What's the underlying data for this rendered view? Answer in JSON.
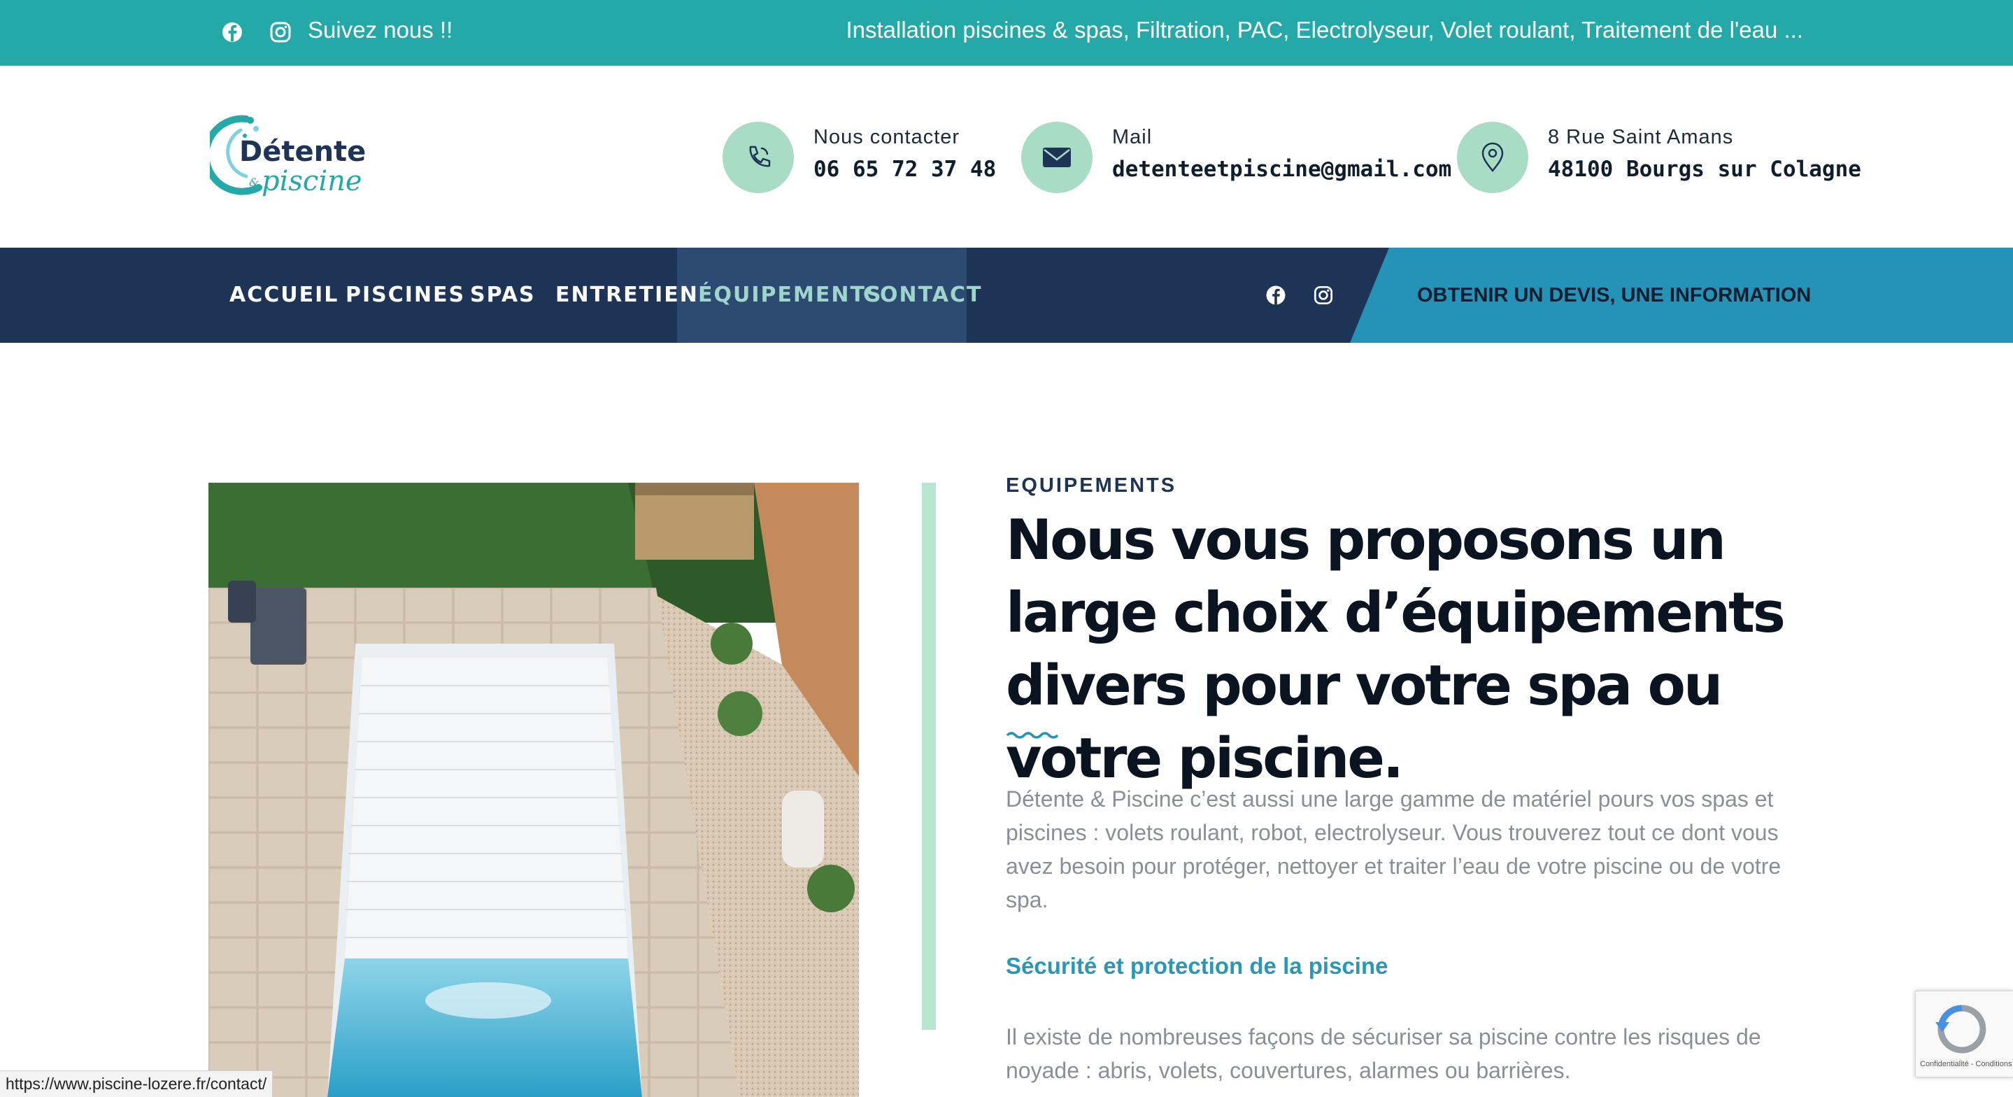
{
  "topbar": {
    "follow_label": "Suivez nous !!",
    "tagline": "Installation piscines & spas, Filtration, PAC, Electrolyseur, Volet roulant, Traitement de l'eau ...",
    "icons": [
      "facebook-icon",
      "instagram-icon"
    ]
  },
  "header": {
    "logo": {
      "line1": "Détente",
      "amp": "&",
      "line2": "piscine"
    },
    "contacts": [
      {
        "icon": "phone-icon",
        "label": "Nous contacter",
        "value": "06 65 72 37 48"
      },
      {
        "icon": "envelope-icon",
        "label": "Mail",
        "value": "detenteetpiscine@gmail.com"
      },
      {
        "icon": "map-pin-icon",
        "label": "8 Rue Saint Amans",
        "value": "48100 Bourgs sur Colagne"
      }
    ]
  },
  "nav": {
    "items": [
      "ACCUEIL",
      "PISCINES",
      "SPAS",
      "ENTRETIEN",
      "ÉQUIPEMENTS",
      "CONTACT"
    ],
    "active": "ÉQUIPEMENTS",
    "cta": "OBTENIR UN DEVIS, UNE INFORMATION"
  },
  "main": {
    "eyebrow": "EQUIPEMENTS",
    "headline": "Nous vous proposons un large choix d’équipements divers pour votre spa ou votre piscine.",
    "intro": "Détente & Piscine c’est aussi une large gamme de matériel pours vos spas et piscines : volets roulant, robot, electrolyseur. Vous trouverez tout ce dont vous avez besoin pour protéger, nettoyer et traiter l’eau de votre piscine ou de votre spa.",
    "subheading": "Sécurité et protection de la piscine",
    "security_text": "Il existe de nombreuses façons de sécuriser sa piscine contre les risques de noyade : abris, volets, couvertures, alarmes ou barrières."
  },
  "status_url": "https://www.piscine-lozere.fr/contact/",
  "recaptcha": {
    "text": "Confidentialité - Conditions"
  },
  "colors": {
    "topbar": "#25a8a8",
    "nav": "#1e3457",
    "cta": "#2593b8",
    "accent_green": "#a8dcc4",
    "link_blue": "#2a98b5"
  }
}
